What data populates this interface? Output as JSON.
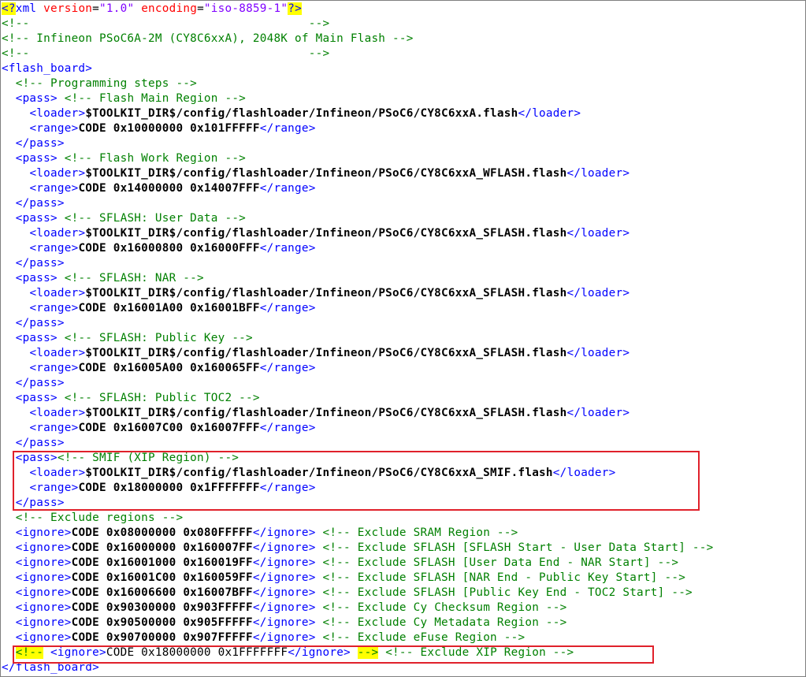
{
  "lines": [
    {
      "segs": [
        {
          "t": "<?",
          "c": "hlblue"
        },
        {
          "t": "xml ",
          "c": "tag"
        },
        {
          "t": "version",
          "c": "attr"
        },
        {
          "t": "=",
          "c": "txt"
        },
        {
          "t": "\"1.0\"",
          "c": "val"
        },
        {
          "t": " ",
          "c": "txt"
        },
        {
          "t": "encoding",
          "c": "attr"
        },
        {
          "t": "=",
          "c": "txt"
        },
        {
          "t": "\"iso-8859-1\"",
          "c": "val"
        },
        {
          "t": "?>",
          "c": "hlblue"
        }
      ]
    },
    {
      "segs": [
        {
          "t": "<!--                                        -->",
          "c": "cm"
        }
      ]
    },
    {
      "segs": [
        {
          "t": "<!-- Infineon PSoC6A-2M (CY8C6xxA), 2048K of Main Flash -->",
          "c": "cm"
        }
      ]
    },
    {
      "segs": [
        {
          "t": "<!--                                        -->",
          "c": "cm"
        }
      ]
    },
    {
      "segs": [
        {
          "t": "<flash_board>",
          "c": "tag"
        }
      ]
    },
    {
      "segs": [
        {
          "t": "  ",
          "c": "txt"
        },
        {
          "t": "<!-- Programming steps -->",
          "c": "cm"
        }
      ]
    },
    {
      "segs": [
        {
          "t": "  ",
          "c": "txt"
        },
        {
          "t": "<pass>",
          "c": "tag"
        },
        {
          "t": " ",
          "c": "txt"
        },
        {
          "t": "<!-- Flash Main Region -->",
          "c": "cm"
        }
      ]
    },
    {
      "segs": [
        {
          "t": "    ",
          "c": "txt"
        },
        {
          "t": "<loader>",
          "c": "tag"
        },
        {
          "t": "$TOOLKIT_DIR$/config/flashloader/Infineon/PSoC6/CY8C6xxA.flash",
          "c": "bold"
        },
        {
          "t": "</loader>",
          "c": "tag"
        }
      ]
    },
    {
      "segs": [
        {
          "t": "    ",
          "c": "txt"
        },
        {
          "t": "<range>",
          "c": "tag"
        },
        {
          "t": "CODE 0x10000000 0x101FFFFF",
          "c": "bold"
        },
        {
          "t": "</range>",
          "c": "tag"
        }
      ]
    },
    {
      "segs": [
        {
          "t": "  ",
          "c": "txt"
        },
        {
          "t": "</pass>",
          "c": "tag"
        }
      ]
    },
    {
      "segs": [
        {
          "t": "  ",
          "c": "txt"
        },
        {
          "t": "<pass>",
          "c": "tag"
        },
        {
          "t": " ",
          "c": "txt"
        },
        {
          "t": "<!-- Flash Work Region -->",
          "c": "cm"
        }
      ]
    },
    {
      "segs": [
        {
          "t": "    ",
          "c": "txt"
        },
        {
          "t": "<loader>",
          "c": "tag"
        },
        {
          "t": "$TOOLKIT_DIR$/config/flashloader/Infineon/PSoC6/CY8C6xxA_WFLASH.flash",
          "c": "bold"
        },
        {
          "t": "</loader>",
          "c": "tag"
        }
      ]
    },
    {
      "segs": [
        {
          "t": "    ",
          "c": "txt"
        },
        {
          "t": "<range>",
          "c": "tag"
        },
        {
          "t": "CODE 0x14000000 0x14007FFF",
          "c": "bold"
        },
        {
          "t": "</range>",
          "c": "tag"
        }
      ]
    },
    {
      "segs": [
        {
          "t": "  ",
          "c": "txt"
        },
        {
          "t": "</pass>",
          "c": "tag"
        }
      ]
    },
    {
      "segs": [
        {
          "t": "  ",
          "c": "txt"
        },
        {
          "t": "<pass>",
          "c": "tag"
        },
        {
          "t": " ",
          "c": "txt"
        },
        {
          "t": "<!-- SFLASH: User Data -->",
          "c": "cm"
        }
      ]
    },
    {
      "segs": [
        {
          "t": "    ",
          "c": "txt"
        },
        {
          "t": "<loader>",
          "c": "tag"
        },
        {
          "t": "$TOOLKIT_DIR$/config/flashloader/Infineon/PSoC6/CY8C6xxA_SFLASH.flash",
          "c": "bold"
        },
        {
          "t": "</loader>",
          "c": "tag"
        }
      ]
    },
    {
      "segs": [
        {
          "t": "    ",
          "c": "txt"
        },
        {
          "t": "<range>",
          "c": "tag"
        },
        {
          "t": "CODE 0x16000800 0x16000FFF",
          "c": "bold"
        },
        {
          "t": "</range>",
          "c": "tag"
        }
      ]
    },
    {
      "segs": [
        {
          "t": "  ",
          "c": "txt"
        },
        {
          "t": "</pass>",
          "c": "tag"
        }
      ]
    },
    {
      "segs": [
        {
          "t": "  ",
          "c": "txt"
        },
        {
          "t": "<pass>",
          "c": "tag"
        },
        {
          "t": " ",
          "c": "txt"
        },
        {
          "t": "<!-- SFLASH: NAR -->",
          "c": "cm"
        }
      ]
    },
    {
      "segs": [
        {
          "t": "    ",
          "c": "txt"
        },
        {
          "t": "<loader>",
          "c": "tag"
        },
        {
          "t": "$TOOLKIT_DIR$/config/flashloader/Infineon/PSoC6/CY8C6xxA_SFLASH.flash",
          "c": "bold"
        },
        {
          "t": "</loader>",
          "c": "tag"
        }
      ]
    },
    {
      "segs": [
        {
          "t": "    ",
          "c": "txt"
        },
        {
          "t": "<range>",
          "c": "tag"
        },
        {
          "t": "CODE 0x16001A00 0x16001BFF",
          "c": "bold"
        },
        {
          "t": "</range>",
          "c": "tag"
        }
      ]
    },
    {
      "segs": [
        {
          "t": "  ",
          "c": "txt"
        },
        {
          "t": "</pass>",
          "c": "tag"
        }
      ]
    },
    {
      "segs": [
        {
          "t": "  ",
          "c": "txt"
        },
        {
          "t": "<pass>",
          "c": "tag"
        },
        {
          "t": " ",
          "c": "txt"
        },
        {
          "t": "<!-- SFLASH: Public Key -->",
          "c": "cm"
        }
      ]
    },
    {
      "segs": [
        {
          "t": "    ",
          "c": "txt"
        },
        {
          "t": "<loader>",
          "c": "tag"
        },
        {
          "t": "$TOOLKIT_DIR$/config/flashloader/Infineon/PSoC6/CY8C6xxA_SFLASH.flash",
          "c": "bold"
        },
        {
          "t": "</loader>",
          "c": "tag"
        }
      ]
    },
    {
      "segs": [
        {
          "t": "    ",
          "c": "txt"
        },
        {
          "t": "<range>",
          "c": "tag"
        },
        {
          "t": "CODE 0x16005A00 0x160065FF",
          "c": "bold"
        },
        {
          "t": "</range>",
          "c": "tag"
        }
      ]
    },
    {
      "segs": [
        {
          "t": "  ",
          "c": "txt"
        },
        {
          "t": "</pass>",
          "c": "tag"
        }
      ]
    },
    {
      "segs": [
        {
          "t": "  ",
          "c": "txt"
        },
        {
          "t": "<pass>",
          "c": "tag"
        },
        {
          "t": " ",
          "c": "txt"
        },
        {
          "t": "<!-- SFLASH: Public TOC2 -->",
          "c": "cm"
        }
      ]
    },
    {
      "segs": [
        {
          "t": "    ",
          "c": "txt"
        },
        {
          "t": "<loader>",
          "c": "tag"
        },
        {
          "t": "$TOOLKIT_DIR$/config/flashloader/Infineon/PSoC6/CY8C6xxA_SFLASH.flash",
          "c": "bold"
        },
        {
          "t": "</loader>",
          "c": "tag"
        }
      ]
    },
    {
      "segs": [
        {
          "t": "    ",
          "c": "txt"
        },
        {
          "t": "<range>",
          "c": "tag"
        },
        {
          "t": "CODE 0x16007C00 0x16007FFF",
          "c": "bold"
        },
        {
          "t": "</range>",
          "c": "tag"
        }
      ]
    },
    {
      "segs": [
        {
          "t": "  ",
          "c": "txt"
        },
        {
          "t": "</pass>",
          "c": "tag"
        }
      ]
    },
    {
      "segs": [
        {
          "t": "  ",
          "c": "txt"
        },
        {
          "t": "<pass>",
          "c": "tag"
        },
        {
          "t": "<!-- SMIF (XIP Region) -->",
          "c": "cm"
        }
      ]
    },
    {
      "segs": [
        {
          "t": "    ",
          "c": "txt"
        },
        {
          "t": "<loader>",
          "c": "tag"
        },
        {
          "t": "$TOOLKIT_DIR$/config/flashloader/Infineon/PSoC6/CY8C6xxA_SMIF.flash",
          "c": "bold"
        },
        {
          "t": "</loader>",
          "c": "tag"
        }
      ]
    },
    {
      "segs": [
        {
          "t": "    ",
          "c": "txt"
        },
        {
          "t": "<range>",
          "c": "tag"
        },
        {
          "t": "CODE 0x18000000 0x1FFFFFFF",
          "c": "bold"
        },
        {
          "t": "</range>",
          "c": "tag"
        }
      ]
    },
    {
      "segs": [
        {
          "t": "  ",
          "c": "txt"
        },
        {
          "t": "</pass>",
          "c": "tag"
        }
      ]
    },
    {
      "segs": [
        {
          "t": "  ",
          "c": "txt"
        },
        {
          "t": "<!-- Exclude regions -->",
          "c": "cm"
        }
      ]
    },
    {
      "segs": [
        {
          "t": "  ",
          "c": "txt"
        },
        {
          "t": "<ignore>",
          "c": "tag"
        },
        {
          "t": "CODE 0x08000000 0x080FFFFF",
          "c": "bold"
        },
        {
          "t": "</ignore>",
          "c": "tag"
        },
        {
          "t": " ",
          "c": "txt"
        },
        {
          "t": "<!-- Exclude SRAM Region -->",
          "c": "cm"
        }
      ]
    },
    {
      "segs": [
        {
          "t": "  ",
          "c": "txt"
        },
        {
          "t": "<ignore>",
          "c": "tag"
        },
        {
          "t": "CODE 0x16000000 0x160007FF",
          "c": "bold"
        },
        {
          "t": "</ignore>",
          "c": "tag"
        },
        {
          "t": " ",
          "c": "txt"
        },
        {
          "t": "<!-- Exclude SFLASH [SFLASH Start - User Data Start] -->",
          "c": "cm"
        }
      ]
    },
    {
      "segs": [
        {
          "t": "  ",
          "c": "txt"
        },
        {
          "t": "<ignore>",
          "c": "tag"
        },
        {
          "t": "CODE 0x16001000 0x160019FF",
          "c": "bold"
        },
        {
          "t": "</ignore>",
          "c": "tag"
        },
        {
          "t": " ",
          "c": "txt"
        },
        {
          "t": "<!-- Exclude SFLASH [User Data End - NAR Start] -->",
          "c": "cm"
        }
      ]
    },
    {
      "segs": [
        {
          "t": "  ",
          "c": "txt"
        },
        {
          "t": "<ignore>",
          "c": "tag"
        },
        {
          "t": "CODE 0x16001C00 0x160059FF",
          "c": "bold"
        },
        {
          "t": "</ignore>",
          "c": "tag"
        },
        {
          "t": " ",
          "c": "txt"
        },
        {
          "t": "<!-- Exclude SFLASH [NAR End - Public Key Start] -->",
          "c": "cm"
        }
      ]
    },
    {
      "segs": [
        {
          "t": "  ",
          "c": "txt"
        },
        {
          "t": "<ignore>",
          "c": "tag"
        },
        {
          "t": "CODE 0x16006600 0x16007BFF",
          "c": "bold"
        },
        {
          "t": "</ignore>",
          "c": "tag"
        },
        {
          "t": " ",
          "c": "txt"
        },
        {
          "t": "<!-- Exclude SFLASH [Public Key End - TOC2 Start] -->",
          "c": "cm"
        }
      ]
    },
    {
      "segs": [
        {
          "t": "  ",
          "c": "txt"
        },
        {
          "t": "<ignore>",
          "c": "tag"
        },
        {
          "t": "CODE 0x90300000 0x903FFFFF",
          "c": "bold"
        },
        {
          "t": "</ignore>",
          "c": "tag"
        },
        {
          "t": " ",
          "c": "txt"
        },
        {
          "t": "<!-- Exclude Cy Checksum Region -->",
          "c": "cm"
        }
      ]
    },
    {
      "segs": [
        {
          "t": "  ",
          "c": "txt"
        },
        {
          "t": "<ignore>",
          "c": "tag"
        },
        {
          "t": "CODE 0x90500000 0x905FFFFF",
          "c": "bold"
        },
        {
          "t": "</ignore>",
          "c": "tag"
        },
        {
          "t": " ",
          "c": "txt"
        },
        {
          "t": "<!-- Exclude Cy Metadata Region -->",
          "c": "cm"
        }
      ]
    },
    {
      "segs": [
        {
          "t": "  ",
          "c": "txt"
        },
        {
          "t": "<ignore>",
          "c": "tag"
        },
        {
          "t": "CODE 0x90700000 0x907FFFFF",
          "c": "bold"
        },
        {
          "t": "</ignore>",
          "c": "tag"
        },
        {
          "t": " ",
          "c": "txt"
        },
        {
          "t": "<!-- Exclude eFuse Region -->",
          "c": "cm"
        }
      ]
    },
    {
      "segs": [
        {
          "t": "  ",
          "c": "txt"
        },
        {
          "t": "<!--",
          "c": "cm hl"
        },
        {
          "t": " ",
          "c": "txt"
        },
        {
          "t": "<ignore>",
          "c": "tag"
        },
        {
          "t": "CODE 0x18000000 0x1FFFFFFF",
          "c": "txt"
        },
        {
          "t": "</ignore>",
          "c": "tag"
        },
        {
          "t": " ",
          "c": "txt"
        },
        {
          "t": "-->",
          "c": "cm hl"
        },
        {
          "t": " ",
          "c": "txt"
        },
        {
          "t": "<!-- Exclude XIP Region -->",
          "c": "cm"
        }
      ]
    },
    {
      "segs": [
        {
          "t": "</flash_board>",
          "c": "tag"
        }
      ]
    }
  ],
  "colors": {
    "tag": "#0000ff",
    "comment": "#008000",
    "attribute": "#ff0000",
    "value": "#8000ff",
    "highlight": "#ffff00",
    "annotation_box": "#e0212b"
  }
}
